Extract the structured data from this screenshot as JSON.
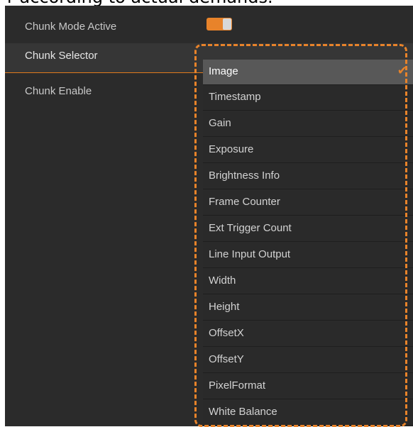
{
  "caption": "r according to actual demands.",
  "params": {
    "chunk_mode_active": "Chunk Mode Active",
    "chunk_selector": "Chunk Selector",
    "chunk_enable": "Chunk Enable"
  },
  "toggle": {
    "state": "on",
    "color": "#e8832a"
  },
  "dropdown": {
    "selected": "Image",
    "items": [
      "Image",
      "Timestamp",
      "Gain",
      "Exposure",
      "Brightness Info",
      "Frame Counter",
      "Ext Trigger Count",
      "Line Input Output",
      "Width",
      "Height",
      "OffsetX",
      "OffsetY",
      "PixelFormat",
      "White Balance"
    ]
  },
  "colors": {
    "accent": "#e8832a",
    "panel": "#2b2b2b",
    "selected_bg": "#585858"
  },
  "icons": {
    "check": "check-icon"
  }
}
